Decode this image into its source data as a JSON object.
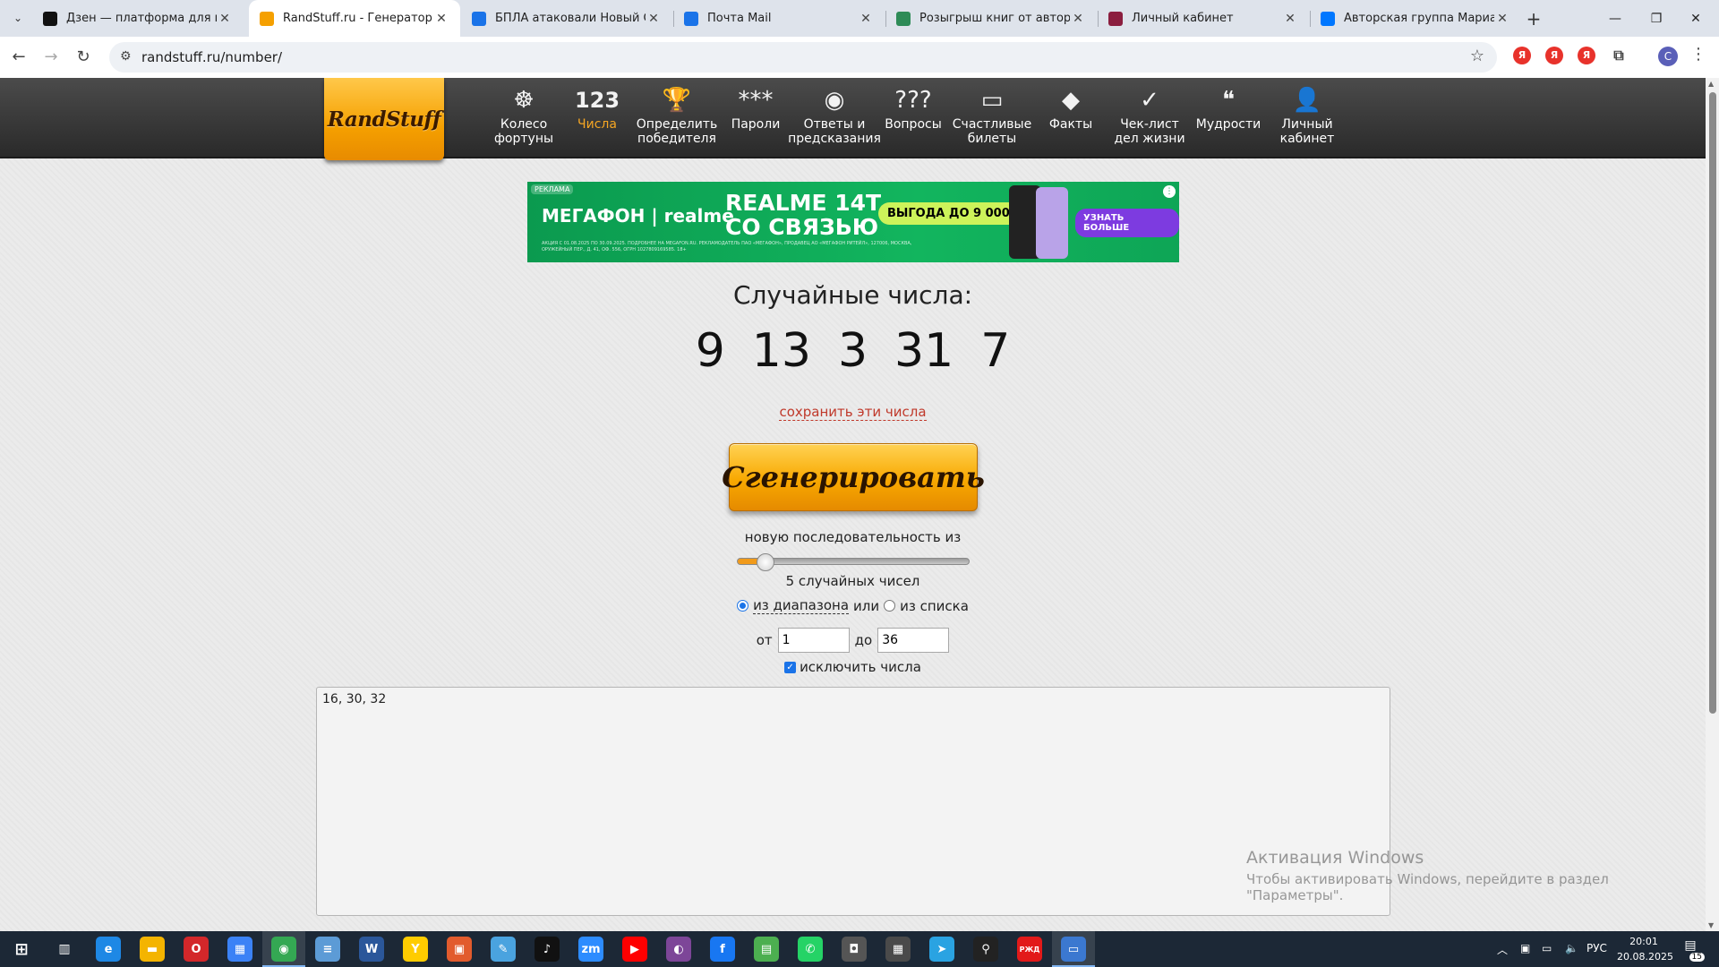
{
  "browser": {
    "tabs": [
      {
        "title": "Дзен — платформа для просм",
        "favicon": "plus-icon",
        "color": "#111111"
      },
      {
        "title": "RandStuff.ru - Генератор случа",
        "favicon": "randstuff-icon",
        "color": "#f5a000",
        "active": true
      },
      {
        "title": "БПЛА атаковали Новый Оскол",
        "favicon": "mail-at-icon",
        "color": "#1a73e8"
      },
      {
        "title": "Почта Mail",
        "favicon": "mail-icon",
        "color": "#1a73e8"
      },
      {
        "title": "Розыгрыш книг от авторов Ли",
        "favicon": "bird-icon",
        "color": "#2e8b57"
      },
      {
        "title": "Личный кабинет",
        "favicon": "litres-icon",
        "color": "#8b1e3f"
      },
      {
        "title": "Авторская группа Марианны",
        "favicon": "vk-icon",
        "color": "#0077ff"
      }
    ],
    "url": "randstuff.ru/number/",
    "profile_initial": "С",
    "ext_letter": "Я"
  },
  "site": {
    "logo": "RandStuff",
    "menu": [
      {
        "icon": "wheel-icon",
        "glyph": "☸",
        "label": [
          "Колесо",
          "фортуны"
        ]
      },
      {
        "icon": "numbers-icon",
        "glyph": "123",
        "label": [
          "Числа"
        ],
        "active": true
      },
      {
        "icon": "trophy-icon",
        "glyph": "🏆",
        "label": [
          "Определить",
          "победителя"
        ]
      },
      {
        "icon": "password-icon",
        "glyph": "***",
        "label": [
          "Пароли"
        ]
      },
      {
        "icon": "magic-ball-icon",
        "glyph": "◉",
        "label": [
          "Ответы и",
          "предсказания"
        ]
      },
      {
        "icon": "questions-icon",
        "glyph": "?‌??",
        "label": [
          "Вопросы"
        ]
      },
      {
        "icon": "ticket-icon",
        "glyph": "▭",
        "label": [
          "Счастливые",
          "билеты"
        ]
      },
      {
        "icon": "fact-icon",
        "glyph": "◆",
        "label": [
          "Факты"
        ]
      },
      {
        "icon": "checklist-icon",
        "glyph": "✓",
        "label": [
          "Чек-лист",
          "дел жизни"
        ]
      },
      {
        "icon": "wisdom-icon",
        "glyph": "❝",
        "label": [
          "Мудрости"
        ]
      },
      {
        "icon": "user-icon",
        "glyph": "👤",
        "label": [
          "Личный",
          "кабинет"
        ]
      }
    ]
  },
  "ad": {
    "tag": "РЕКЛАМА",
    "brand": "МЕГАФОН | realme",
    "headline": [
      "REALME 14T",
      "СО СВЯЗЬЮ"
    ],
    "promo": "ВЫГОДА ДО 9 000 ₽",
    "cta": "УЗНАТЬ БОЛЬШЕ",
    "fine": "АКЦИЯ С 01.08.2025 ПО 30.09.2025. ПОДРОБНЕЕ НА MEGAFON.RU. РЕКЛАМОДАТЕЛЬ ПАО «МЕГАФОН», ПРОДАВЕЦ АО «МЕГАФОН РИТЕЙЛ», 127006, МОСКВА, ОРУЖЕЙНЫЙ ПЕР., Д. 41, ОФ. 556, ОГРН 1027809169585. 18+"
  },
  "main": {
    "title": "Случайные числа:",
    "numbers": [
      "9",
      "13",
      "3",
      "31",
      "7"
    ],
    "save_link": "сохранить эти числа",
    "generate_button": "Сгенерировать",
    "sequence_label": "новую последовательность из",
    "slider_value": 5,
    "slider_max": 100,
    "count_label": "5 случайных чисел",
    "mode_range": "из диапазона",
    "mode_or": "или",
    "mode_list": "из списка",
    "from_label": "от",
    "from_value": "1",
    "to_label": "до",
    "to_value": "36",
    "exclude_label": "исключить числа",
    "exclude_text": "16, 30, 32"
  },
  "watermark": {
    "line1": "Активация Windows",
    "line2": "Чтобы активировать Windows, перейдите в раздел \"Параметры\"."
  },
  "taskbar": {
    "lang": "РУС",
    "time": "20:01",
    "date": "20.08.2025",
    "notifications": "15",
    "apps": [
      {
        "name": "edge-icon",
        "color": "#1e88e5",
        "glyph": "e"
      },
      {
        "name": "explorer-icon",
        "color": "#f4b400",
        "glyph": "▬"
      },
      {
        "name": "opera-icon",
        "color": "#d3272a",
        "glyph": "O"
      },
      {
        "name": "store-icon",
        "color": "#3b82f6",
        "glyph": "▦"
      },
      {
        "name": "chrome-icon",
        "color": "#34a853",
        "glyph": "◉",
        "active": true
      },
      {
        "name": "notepad-icon",
        "color": "#5c9bd6",
        "glyph": "≡"
      },
      {
        "name": "word-icon",
        "color": "#2b579a",
        "glyph": "W"
      },
      {
        "name": "yandex-browser-icon",
        "color": "#ffcc00",
        "glyph": "Y"
      },
      {
        "name": "app-red-icon",
        "color": "#e25b2d",
        "glyph": "▣"
      },
      {
        "name": "paint-icon",
        "color": "#4aa3df",
        "glyph": "✎"
      },
      {
        "name": "tiktok-icon",
        "color": "#111111",
        "glyph": "♪"
      },
      {
        "name": "zoom-icon",
        "color": "#2d8cff",
        "glyph": "zm"
      },
      {
        "name": "youtube-icon",
        "color": "#ff0000",
        "glyph": "▶"
      },
      {
        "name": "tor-icon",
        "color": "#7d4698",
        "glyph": "◐"
      },
      {
        "name": "facebook-icon",
        "color": "#1877f2",
        "glyph": "f"
      },
      {
        "name": "video-icon",
        "color": "#4caf50",
        "glyph": "▤"
      },
      {
        "name": "whatsapp-icon",
        "color": "#25d366",
        "glyph": "✆"
      },
      {
        "name": "camera-app-icon",
        "color": "#555555",
        "glyph": "◘"
      },
      {
        "name": "calculator-icon",
        "color": "#4a4a4a",
        "glyph": "▦"
      },
      {
        "name": "telegram-icon",
        "color": "#2aa3e2",
        "glyph": "➤"
      },
      {
        "name": "maps-pin-icon",
        "color": "#222222",
        "glyph": "⚲"
      },
      {
        "name": "rzd-icon",
        "color": "#e21a1a",
        "glyph": "РЖД"
      },
      {
        "name": "window-app-icon",
        "color": "#3b78d0",
        "glyph": "▭",
        "active": true
      }
    ]
  }
}
